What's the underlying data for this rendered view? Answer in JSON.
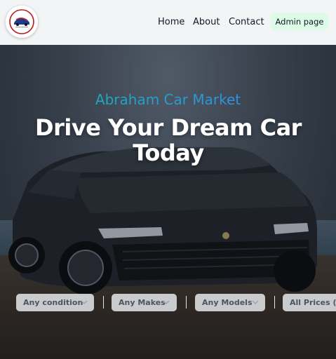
{
  "header": {
    "logo_icon": "car-logo-icon",
    "nav": [
      {
        "label": "Home"
      },
      {
        "label": "About"
      },
      {
        "label": "Contact"
      }
    ],
    "admin_label": "Admin page",
    "admin_color": "#dcfce7"
  },
  "hero": {
    "brand": "Abraham Car Market",
    "headline": "Drive Your Dream Car Today",
    "brand_gradient": [
      "#14b8a6",
      "#3b82f6"
    ]
  },
  "filters": [
    {
      "label": "Any condition",
      "icon": "chevron-down-icon"
    },
    {
      "label": "Any Makes",
      "icon": "chevron-down-icon"
    },
    {
      "label": "Any Models",
      "icon": "chevron-down-icon"
    },
    {
      "label": "All Prices (in",
      "icon": "chevron-down-icon"
    }
  ]
}
